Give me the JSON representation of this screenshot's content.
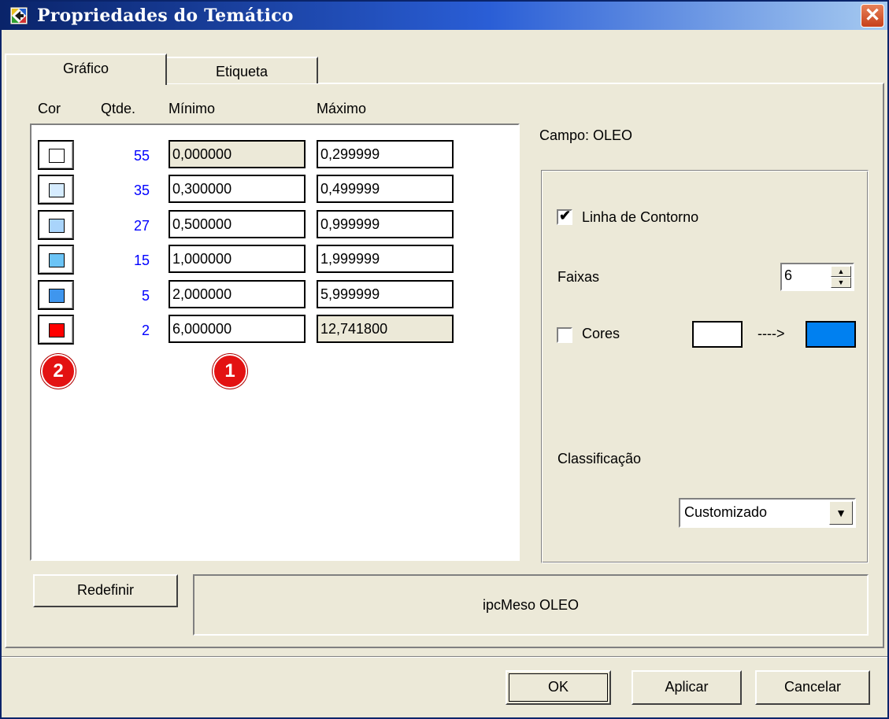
{
  "window": {
    "title": "Propriedades do Temático",
    "close_icon": "close-icon"
  },
  "tabs": [
    {
      "label": "Gráfico",
      "selected": true
    },
    {
      "label": "Etiqueta",
      "selected": false
    }
  ],
  "columns": {
    "cor": "Cor",
    "qtde": "Qtde.",
    "minimo": "Mínimo",
    "maximo": "Máximo"
  },
  "ranges": [
    {
      "color": "#ffffff",
      "qty": "55",
      "min": "0,000000",
      "max": "0,299999",
      "min_readonly": true,
      "max_readonly": false
    },
    {
      "color": "#d6ecff",
      "qty": "35",
      "min": "0,300000",
      "max": "0,499999",
      "min_readonly": false,
      "max_readonly": false
    },
    {
      "color": "#a9d4fb",
      "qty": "27",
      "min": "0,500000",
      "max": "0,999999",
      "min_readonly": false,
      "max_readonly": false
    },
    {
      "color": "#6cc4f6",
      "qty": "15",
      "min": "1,000000",
      "max": "1,999999",
      "min_readonly": false,
      "max_readonly": false
    },
    {
      "color": "#3f96ee",
      "qty": "5",
      "min": "2,000000",
      "max": "5,999999",
      "min_readonly": false,
      "max_readonly": false
    },
    {
      "color": "#ff0000",
      "qty": "2",
      "min": "6,000000",
      "max": "12,741800",
      "min_readonly": false,
      "max_readonly": true
    }
  ],
  "badges": [
    "2",
    "1"
  ],
  "options": {
    "campo_label": "Campo: OLEO",
    "linha_contorno_label": "Linha de Contorno",
    "linha_contorno_checked": true,
    "faixas_label": "Faixas",
    "faixas_value": "6",
    "cores_label": "Cores",
    "cores_checked": false,
    "color_from": "#ffffff",
    "color_to": "#0080f0",
    "arrow_text": "---->",
    "classificacao_label": "Classificação",
    "classificacao_value": "Customizado"
  },
  "buttons": {
    "redefinir": "Redefinir",
    "ok": "OK",
    "aplicar": "Aplicar",
    "cancelar": "Cancelar"
  },
  "status_text": "ipcMeso OLEO"
}
